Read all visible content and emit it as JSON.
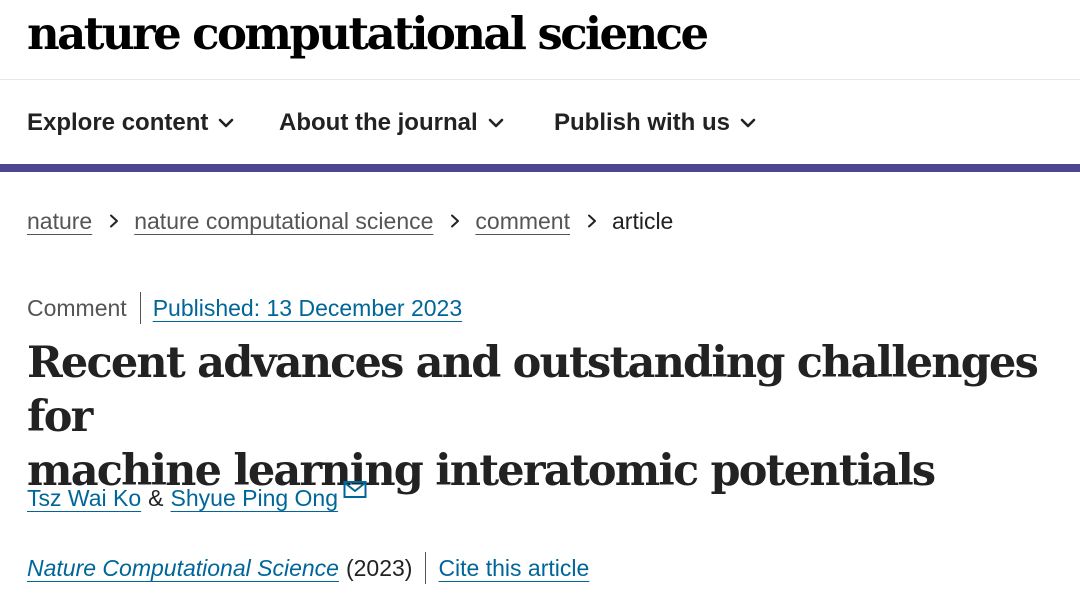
{
  "header": {
    "logo_text": "nature computational science"
  },
  "nav": {
    "items": [
      {
        "label": "Explore content"
      },
      {
        "label": "About the journal"
      },
      {
        "label": "Publish with us"
      }
    ]
  },
  "breadcrumb": {
    "items": [
      {
        "label": "nature"
      },
      {
        "label": "nature computational science"
      },
      {
        "label": "comment"
      }
    ],
    "current": "article"
  },
  "article": {
    "type": "Comment",
    "published": "Published: 13 December 2023",
    "title_line_1": "Recent advances and outstanding challenges for",
    "title_line_2": "machine learning interatomic potentials",
    "authors": [
      {
        "name": "Tsz Wai Ko"
      },
      {
        "name": "Shyue Ping Ong"
      }
    ],
    "author_separator": "&",
    "journal": "Nature Computational Science",
    "year": "(2023)",
    "cite_label": "Cite this article"
  },
  "icons": {
    "nav_chevron": "chevron-down-icon",
    "breadcrumb_separator": "chevron-right-icon",
    "corresponding_author": "mail-icon"
  },
  "colors": {
    "nav_rule": "#4b4790",
    "link": "#006699",
    "text": "#222222",
    "muted": "#555555"
  }
}
